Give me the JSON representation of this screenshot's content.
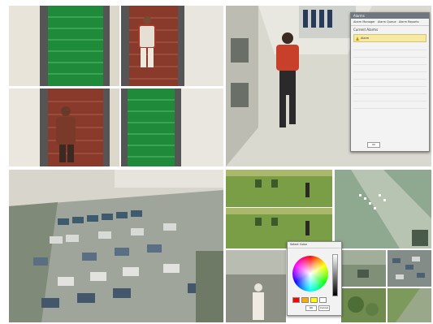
{
  "alarm_panel": {
    "title": "Alarms",
    "tabs": [
      "Alarm Manager",
      "Alarm Queue",
      "Alarm Reports"
    ],
    "heading": "Current Alarms",
    "alarm_label": "Alarm",
    "button": "OK"
  },
  "color_picker": {
    "title": "Select Color",
    "ok": "OK",
    "cancel": "Cancel",
    "swatch_colors": [
      "#ff0000",
      "#ffaa00",
      "#ffff00",
      "#ffffff"
    ]
  },
  "colors": {
    "escalator_green": "#1f8a3a",
    "escalator_red": "#8a3a2a",
    "field_green": "#7a9e45",
    "floor": "#d9d9d0",
    "lot": "#9fa59a",
    "accent": "#d14a33"
  }
}
